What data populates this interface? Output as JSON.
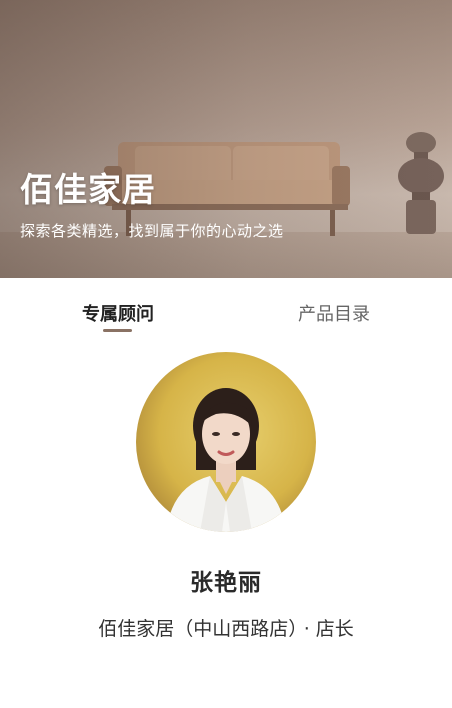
{
  "hero": {
    "brand_name": "佰佳家居",
    "tagline": "探索各类精选，找到属于你的心动之选"
  },
  "tabs": [
    {
      "label": "专属顾问",
      "active": true
    },
    {
      "label": "产品目录",
      "active": false
    }
  ],
  "consultant": {
    "name": "张艳丽",
    "store": "佰佳家居（中山西路店）",
    "separator": "·",
    "title": "店长"
  },
  "colors": {
    "accent": "#8a7264",
    "avatar_background": "#d9b84a"
  }
}
